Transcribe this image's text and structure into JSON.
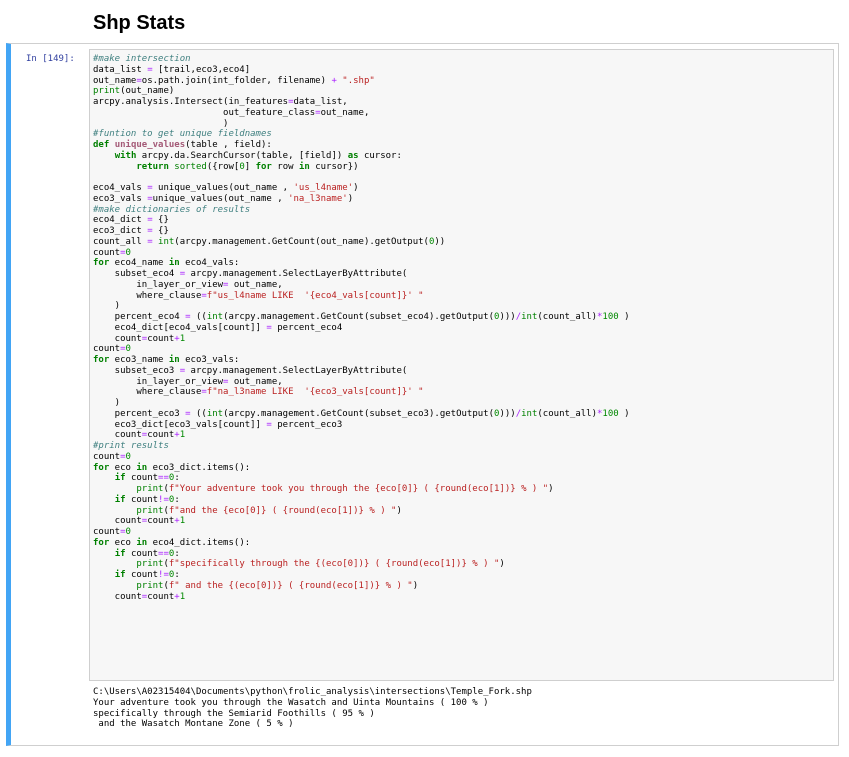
{
  "heading": "Shp Stats",
  "cell": {
    "prompt": "In [149]:",
    "code_lines": [
      [
        {
          "t": "#make intersection",
          "c": "cm"
        }
      ],
      [
        {
          "t": "data_list "
        },
        {
          "t": "=",
          "c": "op"
        },
        {
          "t": " [trail,eco3,eco4]"
        }
      ],
      [
        {
          "t": "out_name"
        },
        {
          "t": "=",
          "c": "op"
        },
        {
          "t": "os.path.join(int_folder, filename) "
        },
        {
          "t": "+",
          "c": "op"
        },
        {
          "t": " "
        },
        {
          "t": "\".shp\"",
          "c": "st"
        }
      ],
      [
        {
          "t": "print",
          "c": "bi"
        },
        {
          "t": "(out_name)"
        }
      ],
      [
        {
          "t": "arcpy.analysis.Intersect(in_features"
        },
        {
          "t": "=",
          "c": "op"
        },
        {
          "t": "data_list,"
        }
      ],
      [
        {
          "t": "                        out_feature_class"
        },
        {
          "t": "=",
          "c": "op"
        },
        {
          "t": "out_name,"
        }
      ],
      [
        {
          "t": "                        )"
        }
      ],
      [
        {
          "t": "#funtion to get unique fieldnames",
          "c": "cm"
        }
      ],
      [
        {
          "t": "def",
          "c": "kw"
        },
        {
          "t": " "
        },
        {
          "t": "unique_values",
          "c": "sb"
        },
        {
          "t": "(table , field):"
        }
      ],
      [
        {
          "t": "    "
        },
        {
          "t": "with",
          "c": "kw"
        },
        {
          "t": " arcpy.da.SearchCursor(table, [field]) "
        },
        {
          "t": "as",
          "c": "kw"
        },
        {
          "t": " cursor:"
        }
      ],
      [
        {
          "t": "        "
        },
        {
          "t": "return",
          "c": "kw"
        },
        {
          "t": " "
        },
        {
          "t": "sorted",
          "c": "bi"
        },
        {
          "t": "({row["
        },
        {
          "t": "0",
          "c": "nm"
        },
        {
          "t": "] "
        },
        {
          "t": "for",
          "c": "kw"
        },
        {
          "t": " row "
        },
        {
          "t": "in",
          "c": "kw"
        },
        {
          "t": " cursor})"
        }
      ],
      [
        {
          "t": ""
        }
      ],
      [
        {
          "t": "eco4_vals "
        },
        {
          "t": "=",
          "c": "op"
        },
        {
          "t": " unique_values(out_name , "
        },
        {
          "t": "'us_l4name'",
          "c": "st"
        },
        {
          "t": ")"
        }
      ],
      [
        {
          "t": "eco3_vals "
        },
        {
          "t": "=",
          "c": "op"
        },
        {
          "t": "unique_values(out_name , "
        },
        {
          "t": "'na_l3name'",
          "c": "st"
        },
        {
          "t": ")"
        }
      ],
      [
        {
          "t": "#make dictionaries of results",
          "c": "cm"
        }
      ],
      [
        {
          "t": "eco4_dict "
        },
        {
          "t": "=",
          "c": "op"
        },
        {
          "t": " {}"
        }
      ],
      [
        {
          "t": "eco3_dict "
        },
        {
          "t": "=",
          "c": "op"
        },
        {
          "t": " {}"
        }
      ],
      [
        {
          "t": "count_all "
        },
        {
          "t": "=",
          "c": "op"
        },
        {
          "t": " "
        },
        {
          "t": "int",
          "c": "bi"
        },
        {
          "t": "(arcpy.management.GetCount(out_name).getOutput("
        },
        {
          "t": "0",
          "c": "nm"
        },
        {
          "t": "))"
        }
      ],
      [
        {
          "t": "count"
        },
        {
          "t": "=",
          "c": "op"
        },
        {
          "t": "0",
          "c": "nm"
        }
      ],
      [
        {
          "t": "for",
          "c": "kw"
        },
        {
          "t": " eco4_name "
        },
        {
          "t": "in",
          "c": "kw"
        },
        {
          "t": " eco4_vals:"
        }
      ],
      [
        {
          "t": "    subset_eco4 "
        },
        {
          "t": "=",
          "c": "op"
        },
        {
          "t": " arcpy.management.SelectLayerByAttribute("
        }
      ],
      [
        {
          "t": "        in_layer_or_view"
        },
        {
          "t": "=",
          "c": "op"
        },
        {
          "t": " out_name,"
        }
      ],
      [
        {
          "t": "        where_clause"
        },
        {
          "t": "=",
          "c": "op"
        },
        {
          "t": "f\"us_l4name LIKE  '{eco4_vals[count]}' \"",
          "c": "st"
        }
      ],
      [
        {
          "t": "    )"
        }
      ],
      [
        {
          "t": "    percent_eco4 "
        },
        {
          "t": "=",
          "c": "op"
        },
        {
          "t": " (("
        },
        {
          "t": "int",
          "c": "bi"
        },
        {
          "t": "(arcpy.management.GetCount(subset_eco4).getOutput("
        },
        {
          "t": "0",
          "c": "nm"
        },
        {
          "t": ")))"
        },
        {
          "t": "/",
          "c": "op"
        },
        {
          "t": "int",
          "c": "bi"
        },
        {
          "t": "(count_all)"
        },
        {
          "t": "*",
          "c": "op"
        },
        {
          "t": "100",
          "c": "nm"
        },
        {
          "t": " )"
        }
      ],
      [
        {
          "t": "    eco4_dict[eco4_vals[count]] "
        },
        {
          "t": "=",
          "c": "op"
        },
        {
          "t": " percent_eco4"
        }
      ],
      [
        {
          "t": "    count"
        },
        {
          "t": "=",
          "c": "op"
        },
        {
          "t": "count"
        },
        {
          "t": "+",
          "c": "op"
        },
        {
          "t": "1",
          "c": "nm"
        }
      ],
      [
        {
          "t": "count"
        },
        {
          "t": "=",
          "c": "op"
        },
        {
          "t": "0",
          "c": "nm"
        }
      ],
      [
        {
          "t": "for",
          "c": "kw"
        },
        {
          "t": " eco3_name "
        },
        {
          "t": "in",
          "c": "kw"
        },
        {
          "t": " eco3_vals:"
        }
      ],
      [
        {
          "t": "    subset_eco3 "
        },
        {
          "t": "=",
          "c": "op"
        },
        {
          "t": " arcpy.management.SelectLayerByAttribute("
        }
      ],
      [
        {
          "t": "        in_layer_or_view"
        },
        {
          "t": "=",
          "c": "op"
        },
        {
          "t": " out_name,"
        }
      ],
      [
        {
          "t": "        where_clause"
        },
        {
          "t": "=",
          "c": "op"
        },
        {
          "t": "f\"na_l3name LIKE  '{eco3_vals[count]}' \"",
          "c": "st"
        }
      ],
      [
        {
          "t": "    )"
        }
      ],
      [
        {
          "t": "    percent_eco3 "
        },
        {
          "t": "=",
          "c": "op"
        },
        {
          "t": " (("
        },
        {
          "t": "int",
          "c": "bi"
        },
        {
          "t": "(arcpy.management.GetCount(subset_eco3).getOutput("
        },
        {
          "t": "0",
          "c": "nm"
        },
        {
          "t": ")))"
        },
        {
          "t": "/",
          "c": "op"
        },
        {
          "t": "int",
          "c": "bi"
        },
        {
          "t": "(count_all)"
        },
        {
          "t": "*",
          "c": "op"
        },
        {
          "t": "100",
          "c": "nm"
        },
        {
          "t": " )"
        }
      ],
      [
        {
          "t": "    eco3_dict[eco3_vals[count]] "
        },
        {
          "t": "=",
          "c": "op"
        },
        {
          "t": " percent_eco3"
        }
      ],
      [
        {
          "t": "    count"
        },
        {
          "t": "=",
          "c": "op"
        },
        {
          "t": "count"
        },
        {
          "t": "+",
          "c": "op"
        },
        {
          "t": "1",
          "c": "nm"
        }
      ],
      [
        {
          "t": "#print results",
          "c": "cm"
        }
      ],
      [
        {
          "t": "count"
        },
        {
          "t": "=",
          "c": "op"
        },
        {
          "t": "0",
          "c": "nm"
        }
      ],
      [
        {
          "t": "for",
          "c": "kw"
        },
        {
          "t": " eco "
        },
        {
          "t": "in",
          "c": "kw"
        },
        {
          "t": " eco3_dict.items():"
        }
      ],
      [
        {
          "t": "    "
        },
        {
          "t": "if",
          "c": "kw"
        },
        {
          "t": " count"
        },
        {
          "t": "==",
          "c": "op"
        },
        {
          "t": "0",
          "c": "nm"
        },
        {
          "t": ":"
        }
      ],
      [
        {
          "t": "        "
        },
        {
          "t": "print",
          "c": "bi"
        },
        {
          "t": "("
        },
        {
          "t": "f\"Your adventure took you through the {eco[0]} ( {round(eco[1])} % ) \"",
          "c": "st"
        },
        {
          "t": ")"
        }
      ],
      [
        {
          "t": "    "
        },
        {
          "t": "if",
          "c": "kw"
        },
        {
          "t": " count"
        },
        {
          "t": "!=",
          "c": "op"
        },
        {
          "t": "0",
          "c": "nm"
        },
        {
          "t": ":"
        }
      ],
      [
        {
          "t": "        "
        },
        {
          "t": "print",
          "c": "bi"
        },
        {
          "t": "("
        },
        {
          "t": "f\"and the {eco[0]} ( {round(eco[1])} % ) \"",
          "c": "st"
        },
        {
          "t": ")"
        }
      ],
      [
        {
          "t": "    count"
        },
        {
          "t": "=",
          "c": "op"
        },
        {
          "t": "count"
        },
        {
          "t": "+",
          "c": "op"
        },
        {
          "t": "1",
          "c": "nm"
        }
      ],
      [
        {
          "t": "count"
        },
        {
          "t": "=",
          "c": "op"
        },
        {
          "t": "0",
          "c": "nm"
        }
      ],
      [
        {
          "t": "for",
          "c": "kw"
        },
        {
          "t": " eco "
        },
        {
          "t": "in",
          "c": "kw"
        },
        {
          "t": " eco4_dict.items():"
        }
      ],
      [
        {
          "t": "    "
        },
        {
          "t": "if",
          "c": "kw"
        },
        {
          "t": " count"
        },
        {
          "t": "==",
          "c": "op"
        },
        {
          "t": "0",
          "c": "nm"
        },
        {
          "t": ":"
        }
      ],
      [
        {
          "t": "        "
        },
        {
          "t": "print",
          "c": "bi"
        },
        {
          "t": "("
        },
        {
          "t": "f\"specifically through the {(eco[0])} ( {round(eco[1])} % ) \"",
          "c": "st"
        },
        {
          "t": ")"
        }
      ],
      [
        {
          "t": "    "
        },
        {
          "t": "if",
          "c": "kw"
        },
        {
          "t": " count"
        },
        {
          "t": "!=",
          "c": "op"
        },
        {
          "t": "0",
          "c": "nm"
        },
        {
          "t": ":"
        }
      ],
      [
        {
          "t": "        "
        },
        {
          "t": "print",
          "c": "bi"
        },
        {
          "t": "("
        },
        {
          "t": "f\" and the {(eco[0])} ( {round(eco[1])} % ) \"",
          "c": "st"
        },
        {
          "t": ")"
        }
      ],
      [
        {
          "t": "    count"
        },
        {
          "t": "=",
          "c": "op"
        },
        {
          "t": "count"
        },
        {
          "t": "+",
          "c": "op"
        },
        {
          "t": "1",
          "c": "nm"
        }
      ]
    ],
    "output_lines": [
      "C:\\Users\\A02315404\\Documents\\python\\frolic_analysis\\intersections\\Temple_Fork.shp",
      "Your adventure took you through the Wasatch and Uinta Mountains ( 100 % )",
      "specifically through the Semiarid Foothills ( 95 % )",
      " and the Wasatch Montane Zone ( 5 % )"
    ]
  }
}
